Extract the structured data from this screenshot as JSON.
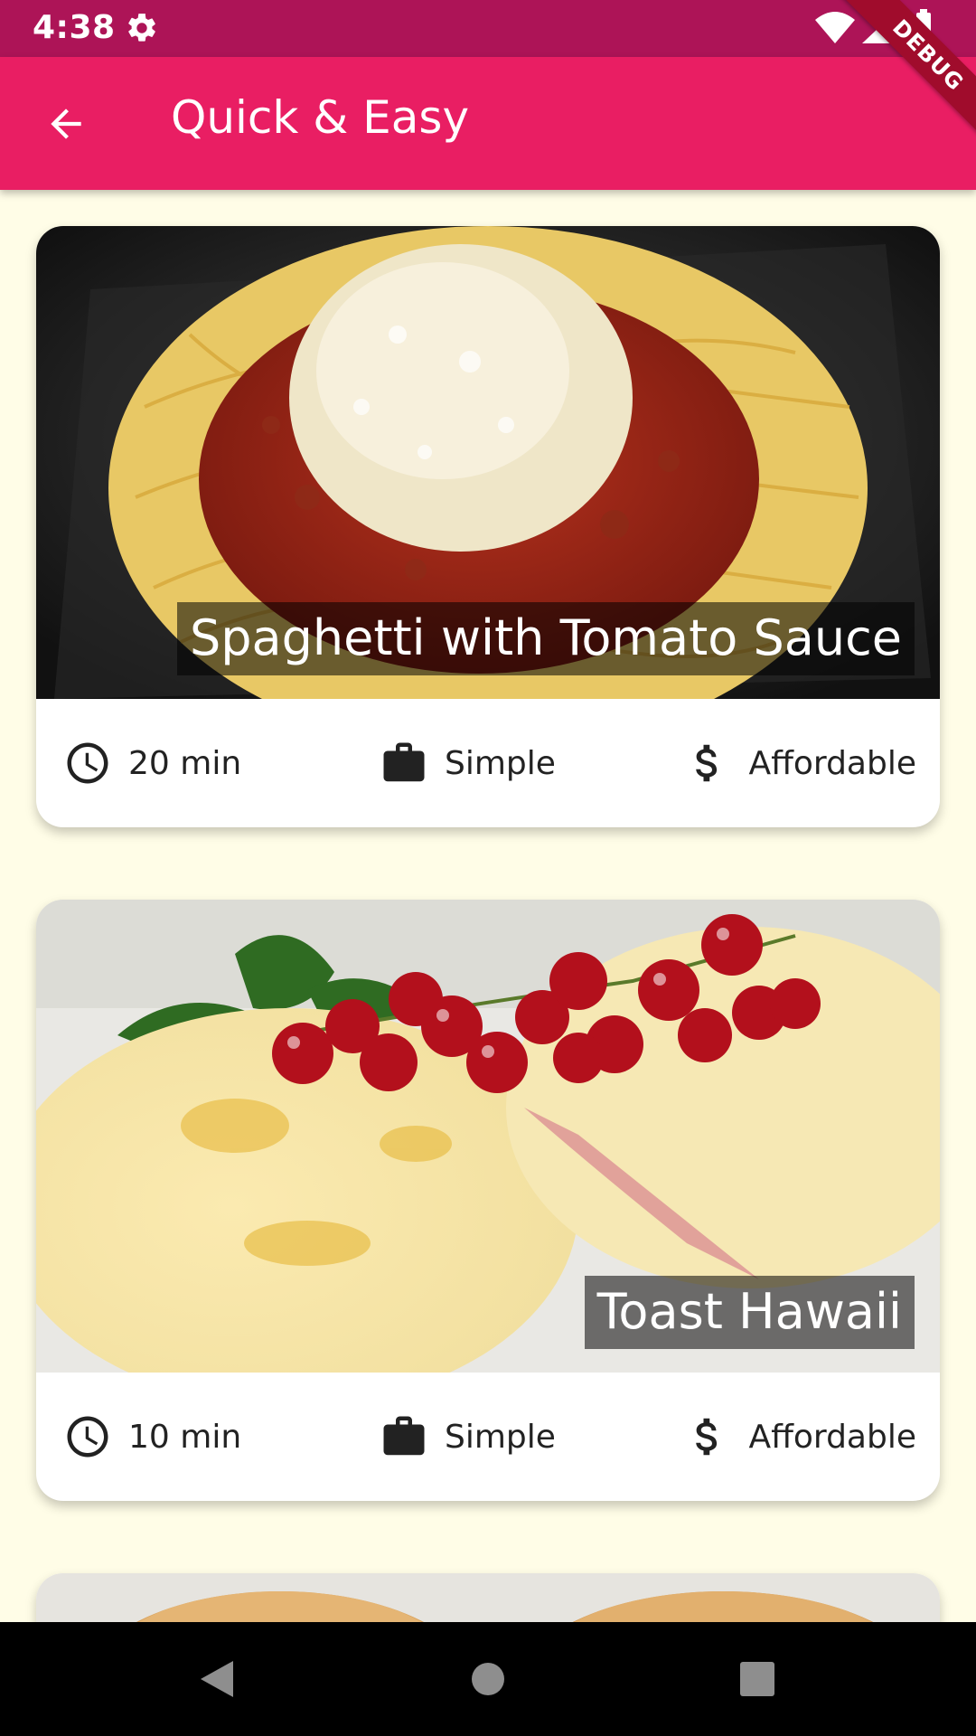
{
  "status_bar": {
    "time": "4:38",
    "icons": [
      "gear-icon",
      "wifi-icon",
      "signal-icon",
      "battery-icon"
    ]
  },
  "app_bar": {
    "title": "Quick & Easy",
    "back_icon": "arrow-back-icon",
    "color": "#e91e63"
  },
  "debug_banner": "DEBUG",
  "meals": [
    {
      "title": "Spaghetti with Tomato Sauce",
      "duration": "20 min",
      "complexity": "Simple",
      "affordability": "Affordable"
    },
    {
      "title": "Toast Hawaii",
      "duration": "10 min",
      "complexity": "Simple",
      "affordability": "Affordable"
    }
  ],
  "nav_bar": {
    "buttons": [
      "back-triangle-icon",
      "home-circle-icon",
      "recents-square-icon"
    ]
  },
  "colors": {
    "status_bar": "#ad1457",
    "app_bar": "#e91e63",
    "background": "#fffde7"
  }
}
